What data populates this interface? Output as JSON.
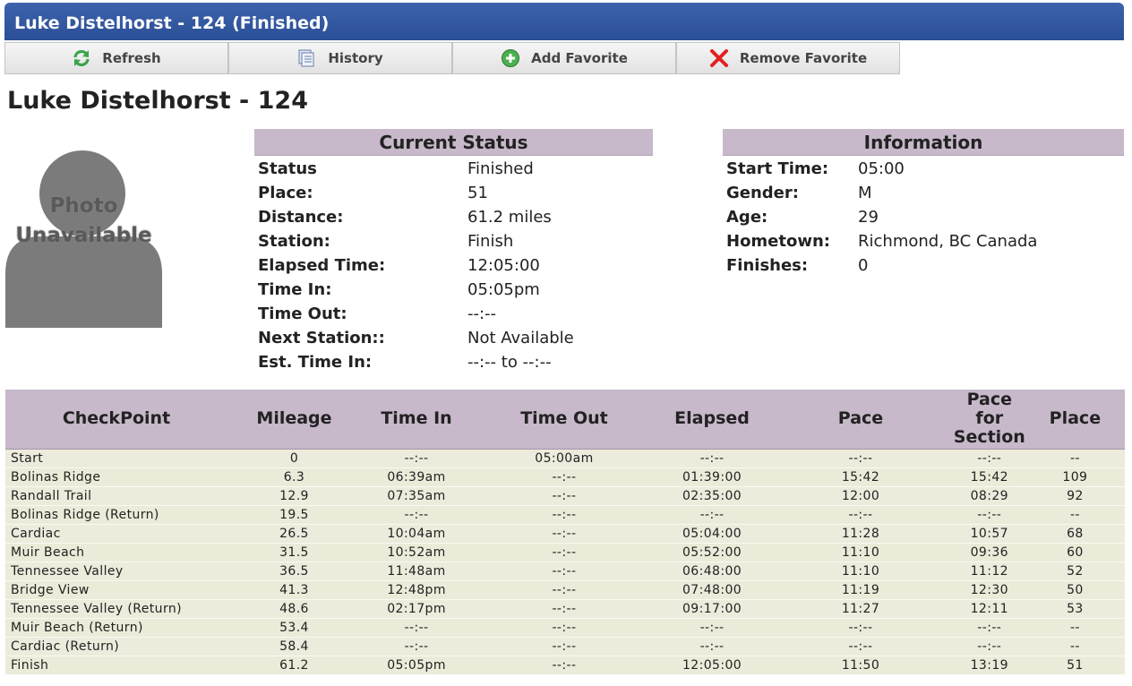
{
  "window": {
    "title": "Luke Distelhorst - 124 (Finished)"
  },
  "toolbar": {
    "refresh": "Refresh",
    "history": "History",
    "add_favorite": "Add Favorite",
    "remove_favorite": "Remove Favorite"
  },
  "runner": {
    "title": "Luke Distelhorst - 124"
  },
  "photo": {
    "line1": "Photo",
    "line2": "Unavailable"
  },
  "current_status": {
    "heading": "Current Status",
    "rows": [
      {
        "label": "Status",
        "value": "Finished"
      },
      {
        "label": "Place:",
        "value": "51"
      },
      {
        "label": "Distance:",
        "value": "61.2 miles"
      },
      {
        "label": "Station:",
        "value": "Finish"
      },
      {
        "label": "Elapsed Time:",
        "value": "12:05:00"
      },
      {
        "label": "Time In:",
        "value": "05:05pm"
      },
      {
        "label": "Time Out:",
        "value": "--:--"
      },
      {
        "label": "Next Station::",
        "value": "Not Available"
      },
      {
        "label": "Est. Time In:",
        "value": "--:-- to --:--"
      }
    ]
  },
  "information": {
    "heading": "Information",
    "rows": [
      {
        "label": "Start Time:",
        "value": "05:00"
      },
      {
        "label": "Gender:",
        "value": "M"
      },
      {
        "label": "Age:",
        "value": "29"
      },
      {
        "label": "Hometown:",
        "value": "Richmond, BC Canada"
      },
      {
        "label": "Finishes:",
        "value": "0"
      }
    ]
  },
  "checkpoints": {
    "headers": [
      "CheckPoint",
      "Mileage",
      "Time In",
      "Time Out",
      "Elapsed",
      "Pace",
      "Pace for Section",
      "Place"
    ],
    "rows": [
      [
        "Start",
        "0",
        "--:--",
        "05:00am",
        "--:--",
        "--:--",
        "--:--",
        "--"
      ],
      [
        "Bolinas Ridge",
        "6.3",
        "06:39am",
        "--:--",
        "01:39:00",
        "15:42",
        "15:42",
        "109"
      ],
      [
        "Randall Trail",
        "12.9",
        "07:35am",
        "--:--",
        "02:35:00",
        "12:00",
        "08:29",
        "92"
      ],
      [
        "Bolinas Ridge (Return)",
        "19.5",
        "--:--",
        "--:--",
        "--:--",
        "--:--",
        "--:--",
        "--"
      ],
      [
        "Cardiac",
        "26.5",
        "10:04am",
        "--:--",
        "05:04:00",
        "11:28",
        "10:57",
        "68"
      ],
      [
        "Muir Beach",
        "31.5",
        "10:52am",
        "--:--",
        "05:52:00",
        "11:10",
        "09:36",
        "60"
      ],
      [
        "Tennessee Valley",
        "36.5",
        "11:48am",
        "--:--",
        "06:48:00",
        "11:10",
        "11:12",
        "52"
      ],
      [
        "Bridge View",
        "41.3",
        "12:48pm",
        "--:--",
        "07:48:00",
        "11:19",
        "12:30",
        "50"
      ],
      [
        "Tennessee Valley (Return)",
        "48.6",
        "02:17pm",
        "--:--",
        "09:17:00",
        "11:27",
        "12:11",
        "53"
      ],
      [
        "Muir Beach (Return)",
        "53.4",
        "--:--",
        "--:--",
        "--:--",
        "--:--",
        "--:--",
        "--"
      ],
      [
        "Cardiac (Return)",
        "58.4",
        "--:--",
        "--:--",
        "--:--",
        "--:--",
        "--:--",
        "--"
      ],
      [
        "Finish",
        "61.2",
        "05:05pm",
        "--:--",
        "12:05:00",
        "11:50",
        "13:19",
        "51"
      ]
    ]
  },
  "colors": {
    "titlebar": "#2f55a0",
    "panel_header": "#c7b8ca",
    "row_bg": "#ecebdc",
    "refresh_icon": "#3aa34a",
    "add_icon": "#4caf50",
    "remove_icon": "#e32020"
  },
  "icons": {
    "refresh": "refresh-icon",
    "history": "history-icon",
    "add_favorite": "add-circle-icon",
    "remove_favorite": "red-x-icon",
    "photo": "person-silhouette-icon"
  }
}
